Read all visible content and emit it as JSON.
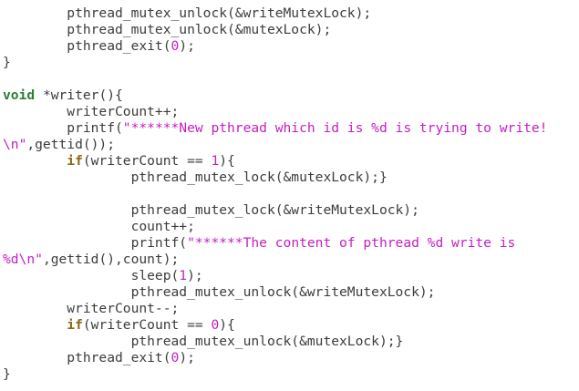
{
  "editor": {
    "lines": [
      [
        {
          "t": "        pthread_mutex_unlock(&writeMutexLock);",
          "k": "plain"
        }
      ],
      [
        {
          "t": "        pthread_mutex_unlock(&mutexLock);",
          "k": "plain"
        }
      ],
      [
        {
          "t": "        pthread_exit(",
          "k": "plain"
        },
        {
          "t": "0",
          "k": "num"
        },
        {
          "t": ");",
          "k": "plain"
        }
      ],
      [
        {
          "t": "}",
          "k": "plain"
        }
      ],
      [],
      [
        {
          "t": "void",
          "k": "type"
        },
        {
          "t": " *writer(){",
          "k": "plain"
        }
      ],
      [
        {
          "t": "        writerCount++;",
          "k": "plain"
        }
      ],
      [
        {
          "t": "        printf(",
          "k": "plain"
        },
        {
          "t": "\"******New pthread which id is %d is trying to write!",
          "k": "str"
        }
      ],
      [
        {
          "t": "\\n\"",
          "k": "str"
        },
        {
          "t": ",gettid());",
          "k": "plain"
        }
      ],
      [
        {
          "t": "        ",
          "k": "plain"
        },
        {
          "t": "if",
          "k": "kw"
        },
        {
          "t": "(writerCount == ",
          "k": "plain"
        },
        {
          "t": "1",
          "k": "num"
        },
        {
          "t": "){",
          "k": "plain"
        }
      ],
      [
        {
          "t": "                pthread_mutex_lock(&mutexLock);}",
          "k": "plain"
        }
      ],
      [],
      [
        {
          "t": "                pthread_mutex_lock(&writeMutexLock);",
          "k": "plain"
        }
      ],
      [
        {
          "t": "                count++;",
          "k": "plain"
        }
      ],
      [
        {
          "t": "                printf(",
          "k": "plain"
        },
        {
          "t": "\"******The content of pthread %d write is",
          "k": "str"
        }
      ],
      [
        {
          "t": "%d\\n\"",
          "k": "str"
        },
        {
          "t": ",gettid(),count);",
          "k": "plain"
        }
      ],
      [
        {
          "t": "                sleep(",
          "k": "plain"
        },
        {
          "t": "1",
          "k": "num"
        },
        {
          "t": ");",
          "k": "plain"
        }
      ],
      [
        {
          "t": "                pthread_mutex_unlock(&writeMutexLock);",
          "k": "plain"
        }
      ],
      [
        {
          "t": "        writerCount--;",
          "k": "plain"
        }
      ],
      [
        {
          "t": "        ",
          "k": "plain"
        },
        {
          "t": "if",
          "k": "kw"
        },
        {
          "t": "(writerCount == ",
          "k": "plain"
        },
        {
          "t": "0",
          "k": "num"
        },
        {
          "t": "){",
          "k": "plain"
        }
      ],
      [
        {
          "t": "                pthread_mutex_unlock(&mutexLock);}",
          "k": "plain"
        }
      ],
      [
        {
          "t": "        pthread_exit(",
          "k": "plain"
        },
        {
          "t": "0",
          "k": "num"
        },
        {
          "t": ");",
          "k": "plain"
        }
      ],
      [
        {
          "t": "}",
          "k": "plain"
        }
      ]
    ]
  },
  "colors": {
    "background": "#ffffff",
    "plain": "#3c3c3c",
    "keyword": "#8a6a14",
    "type": "#2e7d32",
    "string": "#c41ec4",
    "number": "#c41ec4"
  }
}
